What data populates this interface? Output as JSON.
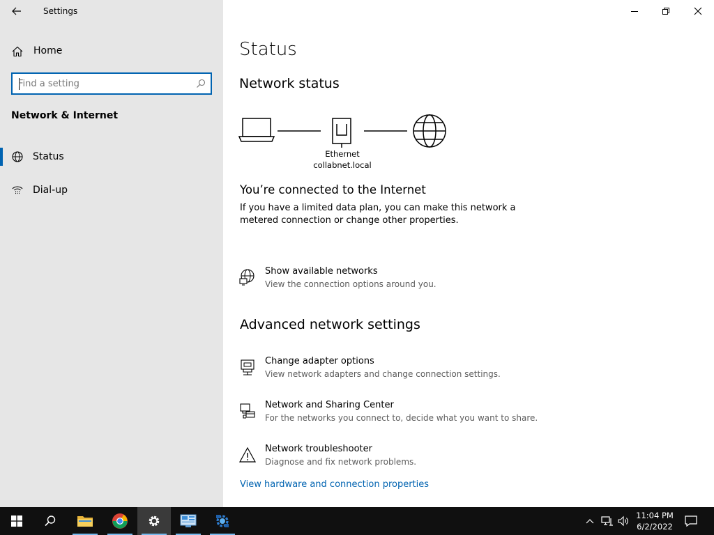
{
  "window": {
    "title": "Settings",
    "controls": {
      "minimize": "minimize",
      "restore": "restore",
      "close": "close"
    }
  },
  "sidebar": {
    "home_label": "Home",
    "search": {
      "placeholder": "Find a setting",
      "value": ""
    },
    "section": "Network & Internet",
    "items": [
      {
        "label": "Status",
        "icon": "status-icon",
        "active": true
      },
      {
        "label": "Dial-up",
        "icon": "dial-up-icon",
        "active": false
      }
    ]
  },
  "main": {
    "title": "Status",
    "network_status_heading": "Network status",
    "diagram": {
      "adapter_name": "Ethernet",
      "network_name": "collabnet.local"
    },
    "connected_heading": "You’re connected to the Internet",
    "connected_text": "If you have a limited data plan, you can make this network a metered connection or change other properties.",
    "show_networks": {
      "title": "Show available networks",
      "subtitle": "View the connection options around you."
    },
    "advanced_heading": "Advanced network settings",
    "advanced_items": [
      {
        "title": "Change adapter options",
        "subtitle": "View network adapters and change connection settings.",
        "icon": "adapter-icon"
      },
      {
        "title": "Network and Sharing Center",
        "subtitle": "For the networks you connect to, decide what you want to share.",
        "icon": "sharing-center-icon"
      },
      {
        "title": "Network troubleshooter",
        "subtitle": "Diagnose and fix network problems.",
        "icon": "warning-icon"
      }
    ],
    "hardware_link": "View hardware and connection properties"
  },
  "taskbar": {
    "apps": [
      "start",
      "search",
      "file-explorer",
      "chrome",
      "settings",
      "control-panel",
      "network-tool"
    ],
    "clock": {
      "time": "11:04 PM",
      "date": "6/2/2022"
    }
  },
  "colors": {
    "accent": "#0063b1",
    "sidebar_bg": "#e6e6e6",
    "taskbar_bg": "#101010"
  }
}
